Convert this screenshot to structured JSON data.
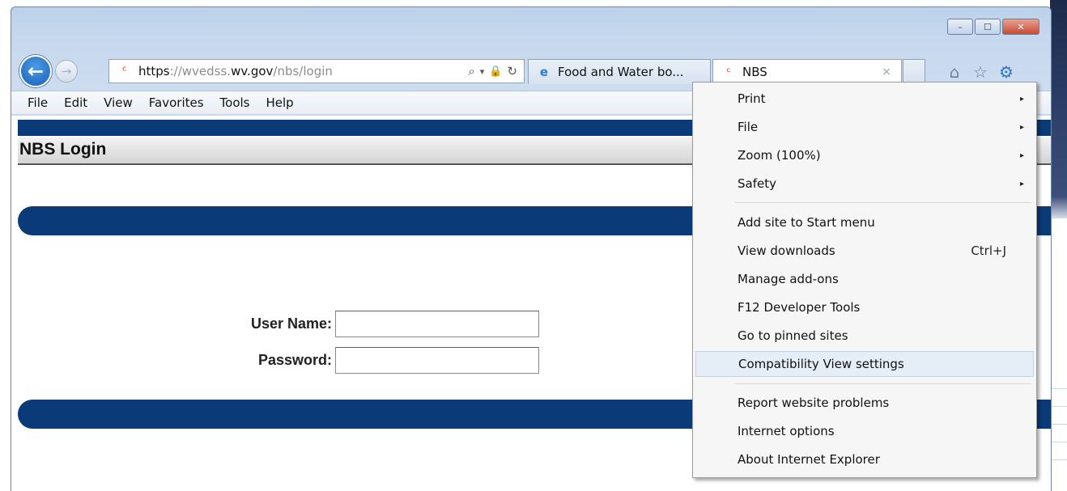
{
  "window": {
    "caption": {
      "minimize": "–",
      "maximize": "☐",
      "close": "✕"
    }
  },
  "nav": {
    "back_icon": "←",
    "forward_icon": "→",
    "address": {
      "favicon": "ᶜ",
      "scheme": "https",
      "sep": "://",
      "sub": "wvedss.",
      "host": "wv.gov",
      "path": "/nbs/login",
      "search_icon": "⌕",
      "dropdown_icon": "▾",
      "lock_icon": "🔒",
      "refresh_icon": "↻"
    },
    "tabs": [
      {
        "label": "Food and Water bo...",
        "icon": "e"
      },
      {
        "label": "NBS",
        "icon": "ᶜ",
        "close": "×"
      }
    ],
    "right_icons": {
      "home": "⌂",
      "favorites": "☆",
      "tools": "⚙"
    }
  },
  "menubar": {
    "items": [
      "File",
      "Edit",
      "View",
      "Favorites",
      "Tools",
      "Help"
    ]
  },
  "page": {
    "title": "NBS Login",
    "username_label": "User Name:",
    "password_label": "Password:",
    "username_value": "",
    "password_value": ""
  },
  "dropdown": {
    "items": [
      {
        "label": "Print",
        "submenu": "▸"
      },
      {
        "label": "File",
        "submenu": "▸"
      },
      {
        "label": "Zoom (100%)",
        "submenu": "▸"
      },
      {
        "label": "Safety",
        "submenu": "▸"
      },
      {
        "label": "Add site to Start menu"
      },
      {
        "label": "View downloads",
        "shortcut": "Ctrl+J"
      },
      {
        "label": "Manage add-ons"
      },
      {
        "label": "F12 Developer Tools"
      },
      {
        "label": "Go to pinned sites"
      },
      {
        "label": "Compatibility View settings",
        "highlighted": true
      },
      {
        "label": "Report website problems"
      },
      {
        "label": "Internet options"
      },
      {
        "label": "About Internet Explorer"
      }
    ]
  },
  "colors": {
    "page_band": "#0b3a79",
    "menu_highlight": "#e5edf7",
    "back_button": "#1b5fb8"
  }
}
